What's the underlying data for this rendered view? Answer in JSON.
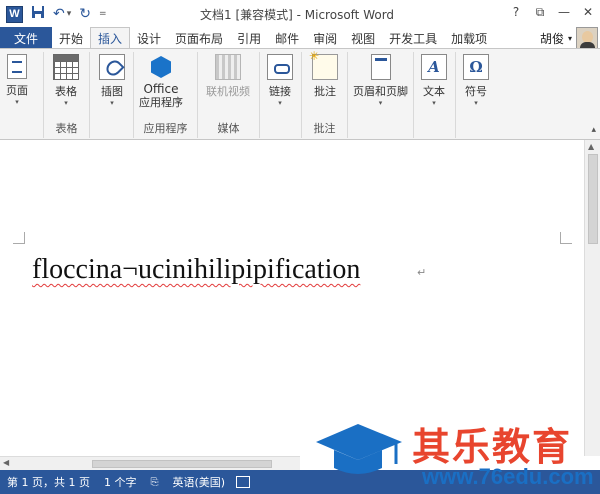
{
  "app": {
    "title": "文档1 [兼容模式] - Microsoft Word",
    "logo_letter": "W",
    "accent_color": "#2b579a"
  },
  "quick_access": {
    "save_icon": "save-icon",
    "undo_glyph": "↶",
    "redo_glyph": "↻",
    "customize_glyph": "="
  },
  "window_controls": {
    "help": "?",
    "ribbon_display": "⧉",
    "minimize": "—",
    "close": "✕"
  },
  "tabs": {
    "file": "文件",
    "items": [
      "开始",
      "插入",
      "设计",
      "页面布局",
      "引用",
      "邮件",
      "审阅",
      "视图",
      "开发工具",
      "加载项"
    ],
    "active": "插入"
  },
  "user": {
    "name": "胡俊",
    "chevron": "▾"
  },
  "ribbon": {
    "groups": [
      {
        "label": ""
      },
      {
        "label": "表格"
      },
      {
        "label": ""
      },
      {
        "label": "应用程序"
      },
      {
        "label": "媒体"
      },
      {
        "label": ""
      },
      {
        "label": "批注"
      },
      {
        "label": ""
      },
      {
        "label": ""
      },
      {
        "label": ""
      }
    ],
    "buttons": {
      "pages": "页面",
      "table": "表格",
      "illustrations": "插图",
      "office_line1": "Office",
      "office_line2": "应用程序",
      "online_video": "联机视频",
      "links": "链接",
      "comment": "批注",
      "header_footer": "页眉和页脚",
      "text": "文本",
      "symbols": "符号",
      "text_icon_glyph": "A",
      "symbol_icon_glyph": "Ω"
    },
    "dropdown_glyph": "▾",
    "collapse_glyph": "▴"
  },
  "document": {
    "text": "floccina¬ucinihilipipification",
    "paragraph_mark": "↵"
  },
  "statusbar": {
    "page": "第 1 页，共 1 页",
    "words": "1 个字",
    "language": "英语(美国)",
    "proofing_glyph": "⎘"
  },
  "watermark": {
    "title": "其乐教育",
    "url": "www.76edu.com",
    "cap_color": "#1a6fc4",
    "title_color": "#e8452e"
  }
}
